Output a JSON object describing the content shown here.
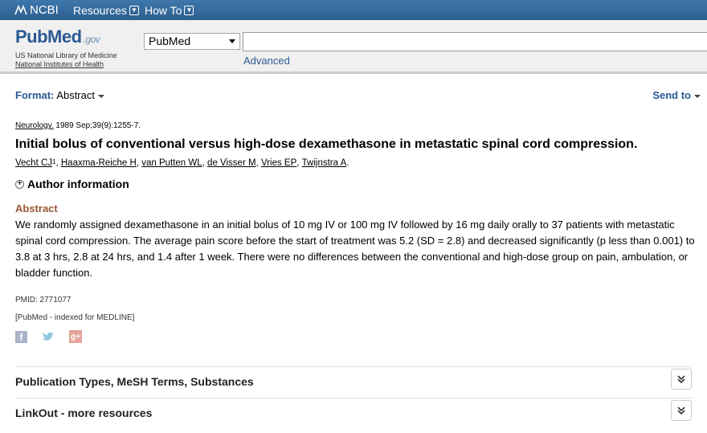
{
  "ncbi_bar": {
    "logo_text": "NCBI",
    "nav": [
      {
        "label": "Resources"
      },
      {
        "label": "How To"
      }
    ]
  },
  "search": {
    "logo": "PubMed",
    "logo_suffix": ".gov",
    "subtitle_line1": "US National Library of Medicine",
    "subtitle_line2": "National Institutes of Health",
    "database": "PubMed",
    "query": "",
    "advanced_label": "Advanced"
  },
  "toolbar": {
    "format_label": "Format:",
    "format_value": "Abstract",
    "send_to_label": "Send to"
  },
  "article": {
    "journal": "Neurology.",
    "citation_rest": " 1989 Sep;39(9):1255-7.",
    "title": "Initial bolus of conventional versus high-dose dexamethasone in metastatic spinal cord compression.",
    "authors": [
      "Vecht CJ",
      "Haaxma-Reiche H",
      "van Putten WL",
      "de Visser M",
      "Vries EP",
      "Twijnstra A"
    ],
    "first_author_sup": "1",
    "author_info_label": "Author information",
    "abstract_heading": "Abstract",
    "abstract_text": "We randomly assigned dexamethasone in an initial bolus of 10 mg IV or 100 mg IV followed by 16 mg daily orally to 37 patients with metastatic spinal cord compression. The average pain score before the start of treatment was 5.2 (SD = 2.8) and decreased significantly (p less than 0.001) to 3.8 at 3 hrs, 2.8 at 24 hrs, and 1.4 after 1 week. There were no differences between the conventional and high-dose group on pain, ambulation, or bladder function.",
    "pmid": "PMID: 2771077",
    "indexed": "[PubMed - indexed for MEDLINE]"
  },
  "social": {
    "facebook_glyph": "f",
    "googleplus_glyph": "g+",
    "icons": [
      "facebook-icon",
      "twitter-icon",
      "google-plus-icon"
    ]
  },
  "sections": [
    {
      "label": "Publication Types, MeSH Terms, Substances"
    },
    {
      "label": "LinkOut - more resources"
    }
  ],
  "colors": {
    "ncbi_bar": "#346a9b",
    "link_blue": "#2a5a92",
    "abstract_heading": "#985735"
  }
}
